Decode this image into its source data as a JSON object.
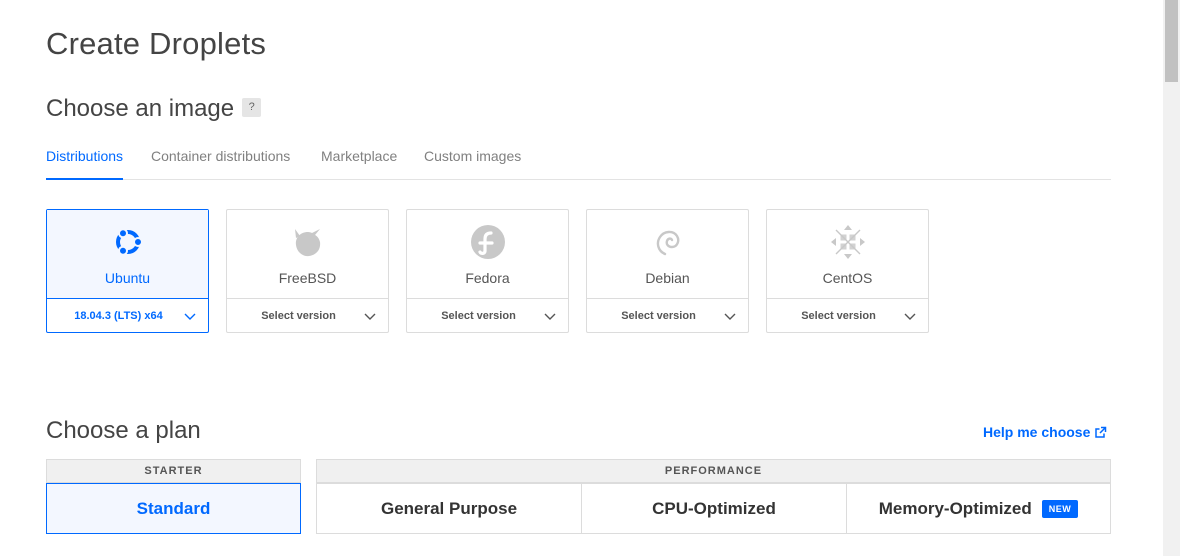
{
  "page": {
    "title": "Create Droplets"
  },
  "image_section": {
    "title": "Choose an image",
    "help_badge": "?",
    "tabs": [
      {
        "label": "Distributions",
        "active": true
      },
      {
        "label": "Container distributions",
        "active": false
      },
      {
        "label": "Marketplace",
        "active": false
      },
      {
        "label": "Custom images",
        "active": false
      }
    ],
    "distros": [
      {
        "name": "Ubuntu",
        "version": "18.04.3 (LTS) x64",
        "selected": true,
        "icon": "ubuntu-icon"
      },
      {
        "name": "FreeBSD",
        "version": "Select version",
        "selected": false,
        "icon": "freebsd-icon"
      },
      {
        "name": "Fedora",
        "version": "Select version",
        "selected": false,
        "icon": "fedora-icon"
      },
      {
        "name": "Debian",
        "version": "Select version",
        "selected": false,
        "icon": "debian-icon"
      },
      {
        "name": "CentOS",
        "version": "Select version",
        "selected": false,
        "icon": "centos-icon"
      }
    ]
  },
  "plan_section": {
    "title": "Choose a plan",
    "help_link": "Help me choose",
    "groups": [
      {
        "label": "STARTER",
        "plans": [
          {
            "label": "Standard",
            "selected": true
          }
        ]
      },
      {
        "label": "PERFORMANCE",
        "plans": [
          {
            "label": "General Purpose",
            "selected": false
          },
          {
            "label": "CPU-Optimized",
            "selected": false
          },
          {
            "label": "Memory-Optimized",
            "selected": false,
            "badge": "NEW"
          }
        ]
      }
    ]
  },
  "colors": {
    "accent": "#0069ff",
    "border": "#dcdcdc",
    "selected_bg": "#f3f7ff"
  }
}
